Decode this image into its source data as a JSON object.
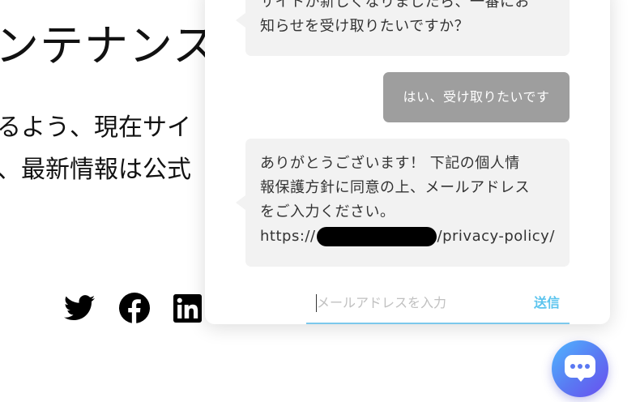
{
  "background_page": {
    "heading": "ンテナンス",
    "lines": [
      "るよう、現在サイ",
      "、最新情報は公式"
    ],
    "social_icons": [
      "twitter-icon",
      "facebook-icon",
      "linkedin-icon"
    ]
  },
  "chat": {
    "messages": [
      {
        "from": "bot",
        "lines": [
          "サイトが新しくなりましたら、一番にお",
          "知らせを受け取りたいですか？"
        ]
      },
      {
        "from": "user",
        "text": "はい、受け取りたいです"
      },
      {
        "from": "bot",
        "lines": [
          "ありがとうございます！ 下記の個人情",
          "報保護方針に同意の上、メールアドレス",
          "をご入力ください。"
        ],
        "link_prefix": "https://",
        "link_suffix": "/privacy-policy/"
      }
    ],
    "input": {
      "placeholder": "メールアドレスを入力",
      "value": ""
    },
    "send_label": "送信"
  },
  "launcher": {
    "icon": "chat-bubble-icon"
  },
  "colors": {
    "accent": "#5bc4ee",
    "user_bubble": "#9e9e9e",
    "bot_bubble": "#f2f2f2",
    "launcher_gradient": [
      "#4fb6ff",
      "#6a4ff0"
    ]
  }
}
